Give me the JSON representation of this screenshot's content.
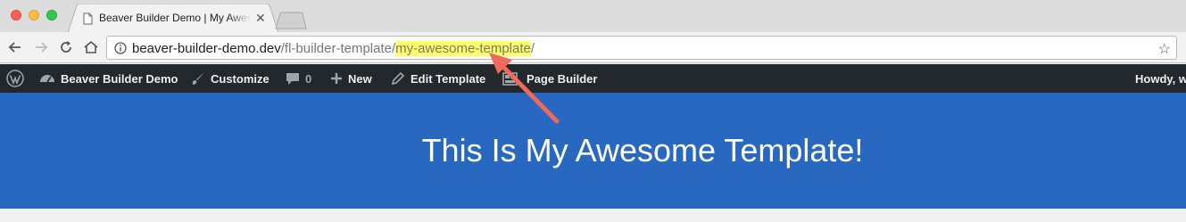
{
  "browser": {
    "tab_title": "Beaver Builder Demo | My Awesome Template",
    "url": {
      "host": "beaver-builder-demo.dev",
      "path_before": "/fl-builder-template/",
      "highlighted": "my-awesome-template",
      "path_after": "/"
    }
  },
  "adminbar": {
    "site_name": "Beaver Builder Demo",
    "customize": "Customize",
    "comments_count": "0",
    "new": "New",
    "edit_template": "Edit Template",
    "page_builder": "Page Builder",
    "howdy": "Howdy, w"
  },
  "hero": {
    "title": "This Is My Awesome Template!"
  },
  "colors": {
    "hero_bg": "#2868c0",
    "adminbar_bg": "#23282d",
    "url_highlight": "#ffff66",
    "arrow": "#ef6a5a"
  },
  "icons": {
    "close": "close-icon",
    "back": "back-arrow-icon",
    "forward": "forward-arrow-icon",
    "reload": "reload-icon",
    "home": "home-icon",
    "info": "info-icon",
    "bookmark": "star-icon",
    "wordpress": "wordpress-icon",
    "dashboard": "dashboard-icon",
    "brush": "brush-icon",
    "comment": "comment-icon",
    "plus": "plus-icon",
    "pencil": "pencil-icon",
    "page_builder": "page-builder-icon"
  }
}
